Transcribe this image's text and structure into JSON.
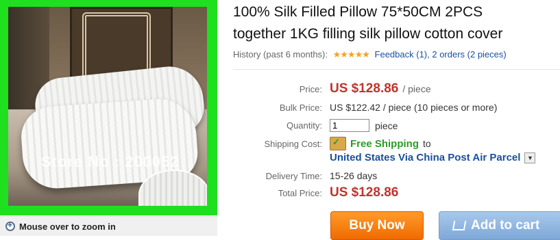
{
  "product": {
    "title_line1": "100% Silk Filled Pillow 75*50CM 2PCS",
    "title_line2": "together 1KG filling silk pillow cotton cover",
    "image_watermark": "Store No : 200052",
    "zoom_hint": "Mouse over to zoom in"
  },
  "history": {
    "label": "History (past 6 months):",
    "rating_stars": 5,
    "stars": "★★★★★",
    "feedback_text": "Feedback (1), 2 orders (2 pieces)"
  },
  "pricing": {
    "price_label": "Price:",
    "price": "US $128.86",
    "price_unit": "/ piece",
    "bulk_label": "Bulk Price:",
    "bulk_value": "US $122.42 / piece (10 pieces or more)",
    "quantity_label": "Quantity:",
    "quantity_value": "1",
    "quantity_unit": "piece",
    "shipping_label": "Shipping Cost:",
    "free_shipping": "Free Shipping",
    "shipping_to": "to",
    "shipping_method": "United States Via China Post Air Parcel",
    "delivery_label": "Delivery Time:",
    "delivery_value": "15-26 days",
    "total_label": "Total Price:",
    "total_value": "US $128.86"
  },
  "actions": {
    "buy_now": "Buy Now",
    "add_to_cart": "Add to cart"
  },
  "colors": {
    "image_border": "#1ee01e",
    "price_red": "#c0332b",
    "link_blue": "#1a4f9c",
    "free_green": "#2b9a2b",
    "buy_orange": "#f07a10",
    "cart_blue": "#8db4e0"
  }
}
